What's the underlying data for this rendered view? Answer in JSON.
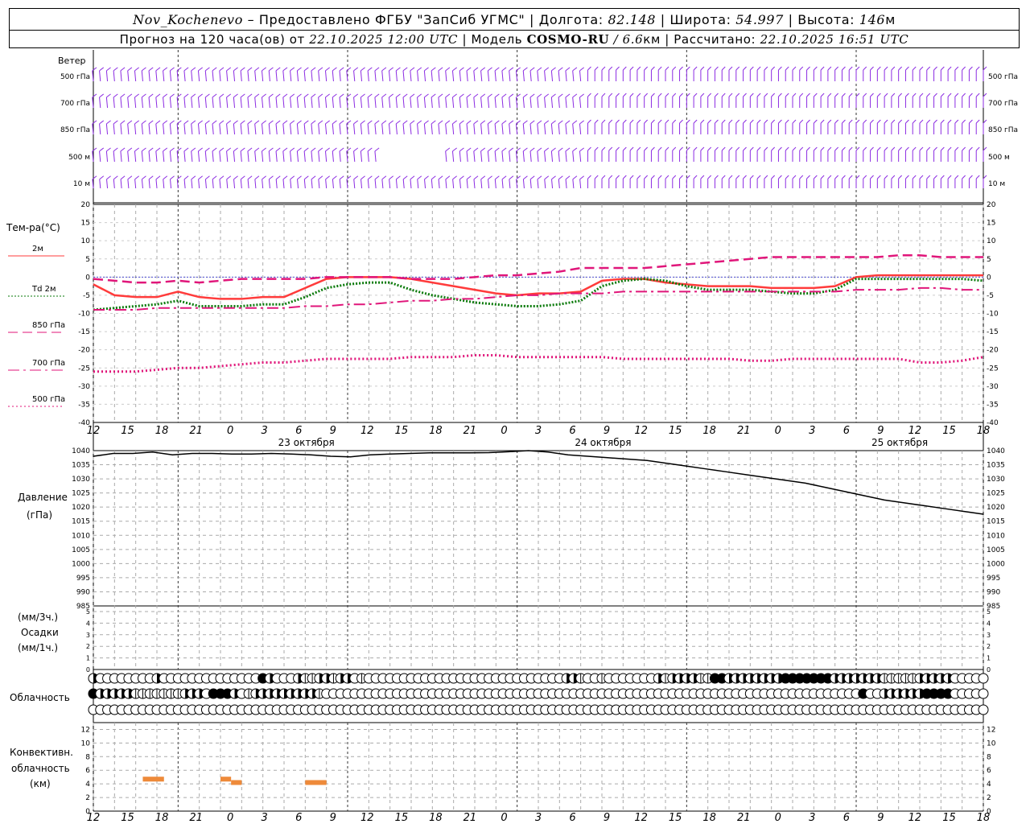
{
  "header": {
    "station": "Nov_Kochenevo",
    "provider": "– Предоставлено ФГБУ \"ЗапСиб УГМС\"",
    "lon_label": "Долгота:",
    "lon": "82.148",
    "lat_label": "Широта:",
    "lat": "54.997",
    "alt_label": "Высота:",
    "alt": "146",
    "alt_unit": "м",
    "forecast_label": "Прогноз на 120 часа(ов) от",
    "forecast_start": "22.10.2025 12:00 UTC",
    "model_label": "Модель",
    "model": "COSMO-RU",
    "resolution": "/ 6.6",
    "res_unit": "км",
    "computed_label": "Рассчитано:",
    "computed": "22.10.2025 16:51 UTC"
  },
  "wind_panel": {
    "title": "Ветер",
    "levels": [
      "500 гПа",
      "700 гПа",
      "850 гПа",
      "500 м",
      "10 м"
    ],
    "color": "#8b2be2"
  },
  "temp_panel": {
    "title": "Тем-ра(°C)",
    "legend": [
      {
        "label": "2м",
        "color": "#ff3b3b",
        "style": "solid"
      },
      {
        "label": "Td 2м",
        "color": "#0a7a0a",
        "style": "dotted"
      },
      {
        "label": "850 гПа",
        "color": "#e0167a",
        "style": "dashed"
      },
      {
        "label": "700 гПа",
        "color": "#e0167a",
        "style": "dashdot"
      },
      {
        "label": "500 гПа",
        "color": "#e0167a",
        "style": "dotted"
      }
    ]
  },
  "pressure_panel": {
    "title_line1": "Давление",
    "title_line2": "(гПа)"
  },
  "precip_panel": {
    "line1": "(мм/3ч.)",
    "line2": "Осадки",
    "line3": "(мм/1ч.)"
  },
  "cloud_panel": {
    "title": "Облачность"
  },
  "conv_panel": {
    "line1": "Конвективн.",
    "line2": "облачность",
    "line3": "(км)",
    "color": "#ee8a3a"
  },
  "time_axis": {
    "hour_labels": [
      "12",
      "15",
      "18",
      "21",
      "0",
      "3",
      "6",
      "9",
      "12",
      "15",
      "18",
      "21",
      "0",
      "3",
      "6",
      "9",
      "12",
      "15",
      "18",
      "21",
      "0",
      "3",
      "6",
      "9",
      "12",
      "15",
      "18"
    ],
    "date_labels": [
      "23 октября",
      "24 октября",
      "25 октября"
    ]
  },
  "chart_data": [
    {
      "type": "line",
      "title": "Тем-ра(°C)",
      "ylim": [
        -40,
        20
      ],
      "yticks": [
        "20",
        "15",
        "10",
        "5",
        "0",
        "-5",
        "-10",
        "-15",
        "-20",
        "-25",
        "-30",
        "-35",
        "-40"
      ],
      "x_hours": [
        0,
        3,
        6,
        9,
        12,
        15,
        18,
        21,
        24,
        27,
        30,
        33,
        36,
        39,
        42,
        45,
        48,
        51,
        54,
        57,
        60,
        63,
        66,
        69,
        72,
        75,
        78,
        81,
        84,
        87,
        90,
        93,
        96,
        99,
        102,
        105,
        108,
        111,
        114,
        117,
        120,
        123,
        126
      ],
      "series": [
        {
          "name": "2м",
          "values": [
            -2,
            -5,
            -5.5,
            -5.5,
            -4,
            -5.5,
            -6,
            -6,
            -5.5,
            -5.5,
            -3,
            -0.5,
            0,
            0,
            0,
            -0.5,
            -1.5,
            -2.5,
            -3.5,
            -4.5,
            -5,
            -4.5,
            -4.5,
            -4,
            -1,
            -0.5,
            -0.5,
            -1.5,
            -2,
            -2.5,
            -2.5,
            -2.5,
            -3,
            -3,
            -3,
            -2.5,
            0,
            0.5,
            0.5,
            0.5,
            0.5,
            0.5,
            0.5
          ]
        },
        {
          "name": "Td 2м",
          "values": [
            -9,
            -8.5,
            -8,
            -7.5,
            -6.5,
            -8,
            -8,
            -8,
            -7.5,
            -7.5,
            -5.5,
            -3,
            -2,
            -1.5,
            -1.5,
            -3.5,
            -5,
            -6,
            -7,
            -7.5,
            -8,
            -8,
            -7.5,
            -6.5,
            -2.5,
            -1,
            -0.5,
            -1,
            -2.5,
            -3.5,
            -3.5,
            -3.5,
            -4,
            -4.5,
            -4.5,
            -3.5,
            -0.5,
            -0.5,
            -0.5,
            -0.5,
            -0.5,
            -0.5,
            -1
          ]
        },
        {
          "name": "850 гПа",
          "values": [
            -0.5,
            -1,
            -1.5,
            -1.5,
            -1,
            -1.5,
            -1,
            -0.5,
            -0.5,
            -0.5,
            -0.5,
            0,
            0,
            0,
            0,
            -0.5,
            -0.5,
            -0.5,
            0,
            0.5,
            0.5,
            1,
            1.5,
            2.5,
            2.5,
            2.5,
            2.5,
            3,
            3.5,
            4,
            4.5,
            5,
            5.5,
            5.5,
            5.5,
            5.5,
            5.5,
            5.5,
            6,
            6,
            5.5,
            5.5,
            5.5
          ]
        },
        {
          "name": "700 гПа",
          "values": [
            -9,
            -9,
            -9,
            -8.5,
            -8.5,
            -8.5,
            -8.5,
            -8.5,
            -8.5,
            -8.5,
            -8,
            -8,
            -7.5,
            -7.5,
            -7,
            -6.5,
            -6.5,
            -6,
            -6,
            -5.5,
            -5,
            -5,
            -4.5,
            -4.5,
            -4.5,
            -4,
            -4,
            -4,
            -4,
            -4,
            -4,
            -4,
            -4,
            -4,
            -4,
            -4,
            -3.5,
            -3.5,
            -3.5,
            -3,
            -3,
            -3.5,
            -3.5
          ]
        },
        {
          "name": "500 гПа",
          "values": [
            -26,
            -26,
            -26,
            -25.5,
            -25,
            -25,
            -24.5,
            -24,
            -23.5,
            -23.5,
            -23,
            -22.5,
            -22.5,
            -22.5,
            -22.5,
            -22,
            -22,
            -22,
            -21.5,
            -21.5,
            -22,
            -22,
            -22,
            -22,
            -22,
            -22.5,
            -22.5,
            -22.5,
            -22.5,
            -22.5,
            -22.5,
            -23,
            -23,
            -22.5,
            -22.5,
            -22.5,
            -22.5,
            -22.5,
            -22.5,
            -23.5,
            -23.5,
            -23,
            -22
          ]
        }
      ]
    },
    {
      "type": "line",
      "title": "Давление (гПа)",
      "ylim": [
        985,
        1040
      ],
      "yticks": [
        "1040",
        "1035",
        "1030",
        "1025",
        "1020",
        "1015",
        "1010",
        "1005",
        "1000",
        "995",
        "990",
        "985"
      ],
      "x_hours": [
        0,
        3,
        6,
        9,
        12,
        15,
        18,
        21,
        24,
        27,
        30,
        33,
        36,
        39,
        42,
        45,
        48,
        51,
        54,
        57,
        60,
        63,
        66,
        69,
        72,
        75,
        78,
        81,
        84,
        87,
        90,
        93,
        96,
        99,
        102,
        105,
        108,
        111,
        114,
        117,
        120,
        123,
        126
      ],
      "series": [
        {
          "name": "Давление",
          "values": [
            1038,
            1039,
            1039,
            1039.5,
            1038.5,
            1039,
            1039,
            1038.8,
            1038.8,
            1039,
            1038.8,
            1038.5,
            1038,
            1037.8,
            1038.5,
            1038.8,
            1039,
            1039.2,
            1039.2,
            1039.2,
            1039.3,
            1039.6,
            1040,
            1039.5,
            1038.5,
            1038,
            1037.5,
            1037,
            1036.5,
            1035.5,
            1034.5,
            1033.5,
            1032.5,
            1031.5,
            1030.5,
            1029.5,
            1028.5,
            1027,
            1025.5,
            1024,
            1022.5,
            1021.5,
            1020.5,
            1019.5,
            1018.5,
            1017.5
          ]
        }
      ]
    },
    {
      "type": "bar",
      "title": "Осадки",
      "ylim": [
        0,
        5
      ],
      "yticks": [
        "5",
        "4",
        "3",
        "2",
        "1",
        "0"
      ],
      "values": []
    },
    {
      "type": "bar",
      "title": "Конвективн. облачность (км)",
      "ylim": [
        0,
        13
      ],
      "yticks": [
        "12",
        "10",
        "8",
        "6",
        "4",
        "2",
        "0"
      ],
      "segments": [
        {
          "start_h": 7,
          "end_h": 10,
          "km": 4.7
        },
        {
          "start_h": 18,
          "end_h": 19.5,
          "km": 4.7
        },
        {
          "start_h": 19.5,
          "end_h": 21,
          "km": 4.2
        },
        {
          "start_h": 30,
          "end_h": 33,
          "km": 4.2
        }
      ]
    },
    {
      "type": "table",
      "title": "Облачность",
      "rows_cover_tenths": [
        [
          8,
          0,
          0,
          0,
          0,
          0,
          0,
          0,
          0,
          5,
          0,
          0,
          0,
          0,
          0,
          0,
          0,
          0,
          0,
          0,
          0,
          0,
          0,
          0,
          10,
          5,
          0,
          0,
          0,
          5,
          2,
          3,
          5,
          5,
          2,
          5,
          5,
          0,
          2,
          0,
          0,
          0,
          0,
          0,
          0,
          0,
          0,
          0,
          0,
          0,
          0,
          0,
          0,
          0,
          0,
          0,
          0,
          0,
          0,
          0,
          0,
          0,
          0,
          0,
          0,
          0,
          0,
          5,
          5,
          3,
          0,
          0,
          2,
          0,
          0,
          0,
          0,
          0,
          0,
          0,
          5,
          2,
          5,
          5,
          5,
          5,
          2,
          3,
          10,
          10,
          8,
          5,
          5,
          5,
          8,
          5,
          5,
          5,
          10,
          10,
          10,
          10,
          10,
          10,
          10,
          8,
          8,
          8,
          8,
          8,
          5,
          5,
          2,
          2,
          2,
          2,
          2,
          5,
          5,
          5,
          5,
          5
        ],
        [
          10,
          8,
          5,
          5,
          8,
          5,
          3,
          2,
          2,
          2,
          2,
          2,
          2,
          5,
          8,
          5,
          0,
          10,
          10,
          10,
          5,
          0,
          2,
          5,
          5,
          5,
          5,
          8,
          5,
          8,
          8,
          5,
          3,
          0,
          0,
          0,
          0,
          0,
          0,
          0,
          0,
          0,
          0,
          0,
          0,
          0,
          0,
          0,
          0,
          0,
          0,
          0,
          0,
          0,
          0,
          0,
          0,
          0,
          0,
          0,
          0,
          0,
          0,
          0,
          0,
          0,
          0,
          0,
          0,
          0,
          0,
          0,
          0,
          0,
          0,
          0,
          0,
          0,
          0,
          0,
          0,
          0,
          0,
          0,
          0,
          0,
          0,
          0,
          0,
          0,
          0,
          0,
          0,
          0,
          0,
          0,
          0,
          0,
          0,
          0,
          0,
          0,
          0,
          0,
          0,
          0,
          0,
          0,
          0,
          10,
          0,
          0,
          5,
          5,
          5,
          5,
          5,
          5,
          10,
          10,
          10,
          10
        ],
        [
          0,
          0,
          0,
          0,
          0,
          0,
          0,
          0,
          0,
          0,
          0,
          0,
          0,
          0,
          0,
          0,
          0,
          0,
          0,
          0,
          0,
          0,
          0,
          0,
          0,
          0,
          0,
          0,
          0,
          0,
          0,
          0,
          0,
          0,
          0,
          0,
          0,
          0,
          0,
          0,
          0,
          0,
          0,
          0,
          0,
          0,
          0,
          0,
          0,
          0,
          0,
          0,
          0,
          0,
          0,
          0,
          0,
          0,
          0,
          0,
          0,
          0,
          0,
          0,
          0,
          0,
          0,
          0,
          0,
          0,
          0,
          0,
          0,
          0,
          0,
          0,
          0,
          0,
          0,
          0,
          0,
          0,
          0,
          0,
          0,
          0,
          0,
          0,
          0,
          0,
          0,
          0,
          0,
          0,
          0,
          0,
          0,
          0,
          0,
          0,
          0,
          0,
          0,
          0,
          0,
          0,
          0,
          0,
          0,
          0,
          0,
          0,
          0,
          0,
          0,
          0,
          0,
          0,
          0,
          0,
          0,
          0,
          0
        ]
      ]
    }
  ]
}
